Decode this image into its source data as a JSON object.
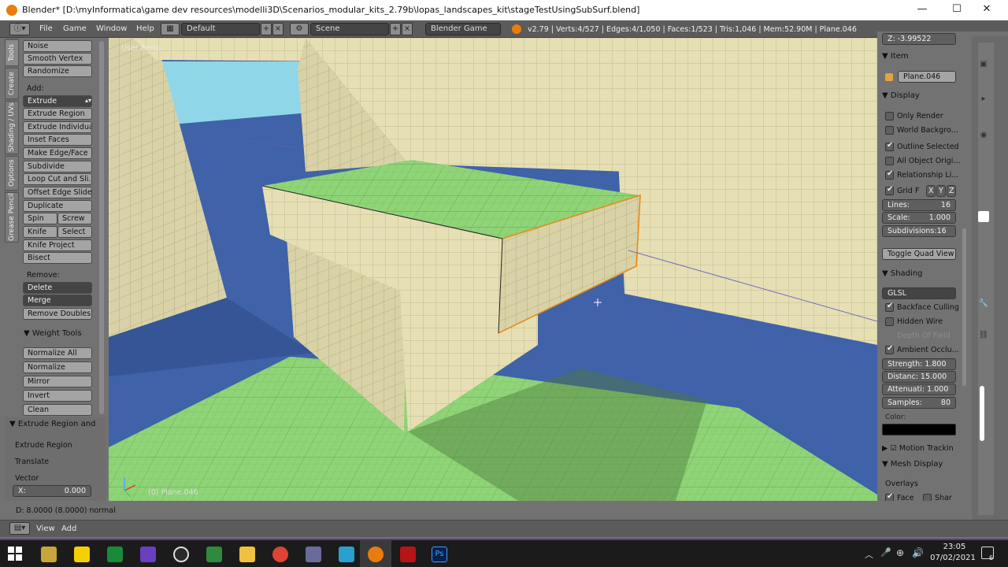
{
  "window": {
    "title": "Blender* [D:\\myInformatica\\game dev resources\\modelli3D\\Scenarios_modular_kits_2.79b\\lopas_landscapes_kit\\stageTestUsingSubSurf.blend]",
    "minimize": "—",
    "maximize": "☐",
    "close": "✕"
  },
  "infobar": {
    "menus": [
      "File",
      "Game",
      "Window",
      "Help"
    ],
    "layout": "Default",
    "scene": "Scene",
    "engine": "Blender Game",
    "stats": "v2.79 | Verts:4/527 | Edges:4/1,050 | Faces:1/523 | Tris:1,046 | Mem:52.90M | Plane.046"
  },
  "vtabs": [
    "Tools",
    "Create",
    "Shading / UVs",
    "Options",
    "Grease Pencil"
  ],
  "toolshelf": {
    "top_buttons": [
      "Noise",
      "Smooth Vertex",
      "Randomize"
    ],
    "add_label": "Add:",
    "extrude_dropdown": "Extrude",
    "add_buttons": [
      "Extrude Region",
      "Extrude Individual",
      "Inset Faces",
      "Make Edge/Face",
      "Subdivide",
      "Loop Cut and Sli...",
      "Offset Edge Slide",
      "Duplicate"
    ],
    "spin": "Spin",
    "screw": "Screw",
    "knife": "Knife",
    "select": "Select",
    "more_buttons": [
      "Knife Project",
      "Bisect"
    ],
    "remove_label": "Remove:",
    "delete": "Delete",
    "merge": "Merge",
    "remove_doubles": "Remove Doubles",
    "weight_tools": "Weight Tools",
    "weight_buttons": [
      "Normalize All",
      "Normalize",
      "Mirror",
      "Invert",
      "Clean"
    ],
    "operator_title": "Extrude Region and",
    "operator_items": [
      "Extrude Region",
      "Translate",
      "Vector"
    ],
    "vector_x": "X:",
    "vector_x_value": "0.000"
  },
  "viewport": {
    "view_label": "User Persp",
    "object_label": "(0) Plane.046"
  },
  "npanel": {
    "z_value": "Z:       -3.99522",
    "item_header": "Item",
    "item_name": "Plane.046",
    "display_header": "Display",
    "display_checks": [
      {
        "label": "Only Render",
        "on": false
      },
      {
        "label": "World Backgro...",
        "on": false
      },
      {
        "label": "Outline Selected",
        "on": true
      },
      {
        "label": "All Object Origi...",
        "on": false
      },
      {
        "label": "Relationship Li...",
        "on": true
      }
    ],
    "grid_floor": "Grid F",
    "axes": [
      "X",
      "Y",
      "Z"
    ],
    "lines": "Lines:",
    "lines_value": "16",
    "scale": "Scale:",
    "scale_value": "1.000",
    "subdivisions": "Subdivisions:16",
    "toggle_quad": "Toggle Quad View",
    "shading_header": "Shading",
    "shading_mode": "GLSL",
    "shading_checks": [
      {
        "label": "Backface Culling",
        "on": true,
        "dim": false
      },
      {
        "label": "Hidden Wire",
        "on": false,
        "dim": false
      },
      {
        "label": "Depth Of Field",
        "on": false,
        "dim": true
      },
      {
        "label": "Ambient Occlu...",
        "on": true,
        "dim": false
      }
    ],
    "strength": "Strength: 1.800",
    "distance": "Distanc: 15.000",
    "attenuation": "Attenuati: 1.000",
    "samples": "Samples:",
    "samples_value": "80",
    "color_label": "Color:",
    "motion_tracking": "Motion Trackin",
    "mesh_display": "Mesh Display",
    "overlays": "Overlays",
    "face": "Face",
    "sharp": "Shar"
  },
  "statusline": "D: 8.0000 (8.0000) normal",
  "bottombar": {
    "view": "View",
    "add": "Add"
  },
  "taskbar": {
    "time": "23:05",
    "date": "07/02/2021",
    "notification_count": "6"
  },
  "colors": {
    "floor_green": "#8fd477",
    "wall_cream": "#e6dfb4",
    "ground_blue": "#3f62a8",
    "sky": "#8fd7e8",
    "taskbar_accent": "#5a3590"
  }
}
